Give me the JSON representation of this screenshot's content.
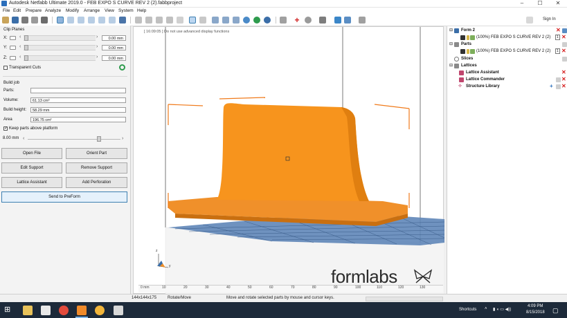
{
  "window": {
    "title": "Autodesk Netfabb Ultimate 2019.0 - FEB EXPO S CURVE REV 2 (2).fabbproject",
    "minimize": "–",
    "maximize": "☐",
    "close": "✕"
  },
  "menu": [
    "File",
    "Edit",
    "Prepare",
    "Analyze",
    "Modify",
    "Arrange",
    "View",
    "System",
    "Help"
  ],
  "signin": "Sign In",
  "clip_planes": {
    "title": "Clip Planes",
    "axes": [
      {
        "label": "X:",
        "value": "0.00 mm"
      },
      {
        "label": "Y:",
        "value": "0.00 mm"
      },
      {
        "label": "Z:",
        "value": "0.00 mm"
      }
    ],
    "transparent_cuts": "Transparent Cuts"
  },
  "build_job": {
    "title": "Build job",
    "parts_label": "Parts:",
    "parts_value": "",
    "volume_label": "Volume:",
    "volume_value": "61.13 cm³",
    "height_label": "Build height:",
    "height_value": "58.29 mm",
    "area_label": "Area",
    "area_value": "196.75 cm²",
    "keep_parts": "Keep parts above platform",
    "offset_value": "8.00 mm"
  },
  "buttons": {
    "open_file": "Open File",
    "orient_part": "Orient Part",
    "edit_support": "Edit Support",
    "remove_support": "Remove Support",
    "lattice_assistant": "Lattice Assistant",
    "add_perforation": "Add Perforation",
    "send_to_preform": "Send to PreForm"
  },
  "viewport": {
    "message": "[ 16:09:05 ] Do not use advanced display functions",
    "brand": "formlabs",
    "axis_z": "z",
    "axis_y": "y",
    "ruler_labels": [
      "0 mm",
      "10",
      "20",
      "30",
      "40",
      "50",
      "60",
      "70",
      "80",
      "90",
      "100",
      "110",
      "120",
      "130"
    ]
  },
  "tree": {
    "form": "Form 2",
    "form_part": "(100%) FEB EXPO S CURVE REV 2 (2)",
    "parts": "Parts",
    "parts_part": "(100%) FEB EXPO S CURVE REV 2 (2)",
    "slices": "Slices",
    "lattices": "Lattices",
    "lattice_assistant": "Lattice Assistant",
    "lattice_commander": "Lattice Commander",
    "structure_library": "Structure Library",
    "badge": "1"
  },
  "status": {
    "dims": "144x144x175",
    "mode": "Rotate/Move",
    "hint": "Move and rotate selected parts by mouse and cursor keys."
  },
  "taskbar": {
    "shortcuts": "Shortcuts",
    "time": "4:09 PM",
    "date": "8/15/2018"
  },
  "colors": {
    "part": "#f7941d",
    "platform_grid": "#4a74a8",
    "accent": "#2a6ebb",
    "close_red": "#d62020"
  }
}
